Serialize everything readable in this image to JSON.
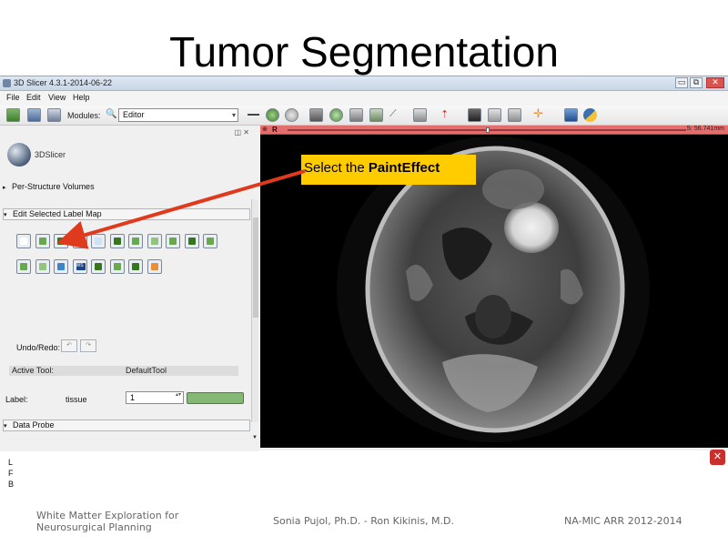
{
  "slide": {
    "title": "Tumor Segmentation",
    "footer_left_line1": "White Matter Exploration for",
    "footer_left_line2": "Neurosurgical Planning",
    "footer_center": "Sonia Pujol, Ph.D. - Ron Kikinis, M.D.",
    "footer_right": "NA-MIC ARR 2012-2014"
  },
  "window": {
    "title": "3D Slicer 4.3.1-2014-06-22",
    "minimize_glyph": "▭",
    "maximize_glyph": "⧉",
    "close_glyph": "✕"
  },
  "menu": [
    "File",
    "Edit",
    "View",
    "Help"
  ],
  "toolbar": {
    "data_label": "DATA",
    "dcm_label": "DCM",
    "save_label": "SAVE",
    "modules_label": "Modules:",
    "module_value": "Editor",
    "dropdown_glyph": "▾"
  },
  "panel": {
    "controls_glyph": "◫ ✕",
    "logo_text": "3DSlicer",
    "per_structure_volumes": "Per-Structure Volumes",
    "edit_selected_label_map": "Edit Selected Label Map",
    "collapsed_arrow": "▸",
    "expanded_arrow": "▾",
    "undo_redo_label": "Undo/Redo:",
    "undo_glyph": "↶",
    "redo_glyph": "↷",
    "active_tool_label": "Active Tool:",
    "active_tool_value": "DefaultTool",
    "label_label": "Label:",
    "label_name": "tissue",
    "label_value": "1",
    "spin_glyph": "▴▾",
    "data_probe": "Data Probe",
    "coords": [
      "L",
      "F",
      "B"
    ]
  },
  "tools_row1": [
    {
      "name": "default-tool-button",
      "icon": "pointer-icon",
      "color": "#ffffff"
    },
    {
      "name": "change-label-button",
      "icon": "label-icon",
      "color": "#6aa84f"
    },
    {
      "name": "paint-effect-button",
      "icon": "paintbrush-icon",
      "color": "#38761d"
    },
    {
      "name": "draw-effect-button",
      "icon": "pencil-icon",
      "color": "#93c47d"
    },
    {
      "name": "level-tracing-button",
      "icon": "wand-icon",
      "color": "#cfe2f3"
    },
    {
      "name": "image-label-button",
      "icon": "image-icon",
      "color": "#38761d"
    },
    {
      "name": "rectangle-button",
      "icon": "rectangle-icon",
      "color": "#6aa84f"
    },
    {
      "name": "threshold-button",
      "icon": "grid-icon",
      "color": "#93c47d"
    },
    {
      "name": "erode-button",
      "icon": "grid-icon",
      "color": "#6aa84f"
    },
    {
      "name": "dilate-button",
      "icon": "grid-icon",
      "color": "#38761d"
    },
    {
      "name": "island-button",
      "icon": "curve-icon",
      "color": "#6aa84f"
    }
  ],
  "tools_row2": [
    {
      "name": "identify-islands-button",
      "icon": "crosshair-icon",
      "color": "#6aa84f"
    },
    {
      "name": "change-island-button",
      "icon": "crosshair-icon",
      "color": "#93c47d"
    },
    {
      "name": "remove-islands-button",
      "icon": "arrow-icon",
      "color": "#3d85c6"
    },
    {
      "name": "watershed-button",
      "icon": "ws-icon",
      "label": "WS",
      "color": "#1c4587"
    },
    {
      "name": "save-island-button",
      "icon": "stamp-icon",
      "color": "#38761d"
    },
    {
      "name": "fast-marching-button",
      "icon": "stamp-icon",
      "color": "#6aa84f"
    },
    {
      "name": "grow-cut-button",
      "icon": "bucket-icon",
      "color": "#38761d"
    },
    {
      "name": "wand-effect-button",
      "icon": "target-icon",
      "color": "#e69138"
    }
  ],
  "viewer": {
    "pin_glyph": "⊕",
    "orientation": "R",
    "offset": "S: 56.741mm"
  },
  "callout": {
    "prefix": "Select the ",
    "emphasis": "PaintEffect"
  },
  "colors": {
    "red_slice_bar": "#e46d6d",
    "callout_bg": "#ffcc00",
    "arrow": "#e03a1e",
    "label_color": "#85b874"
  },
  "close_badge_glyph": "✕"
}
